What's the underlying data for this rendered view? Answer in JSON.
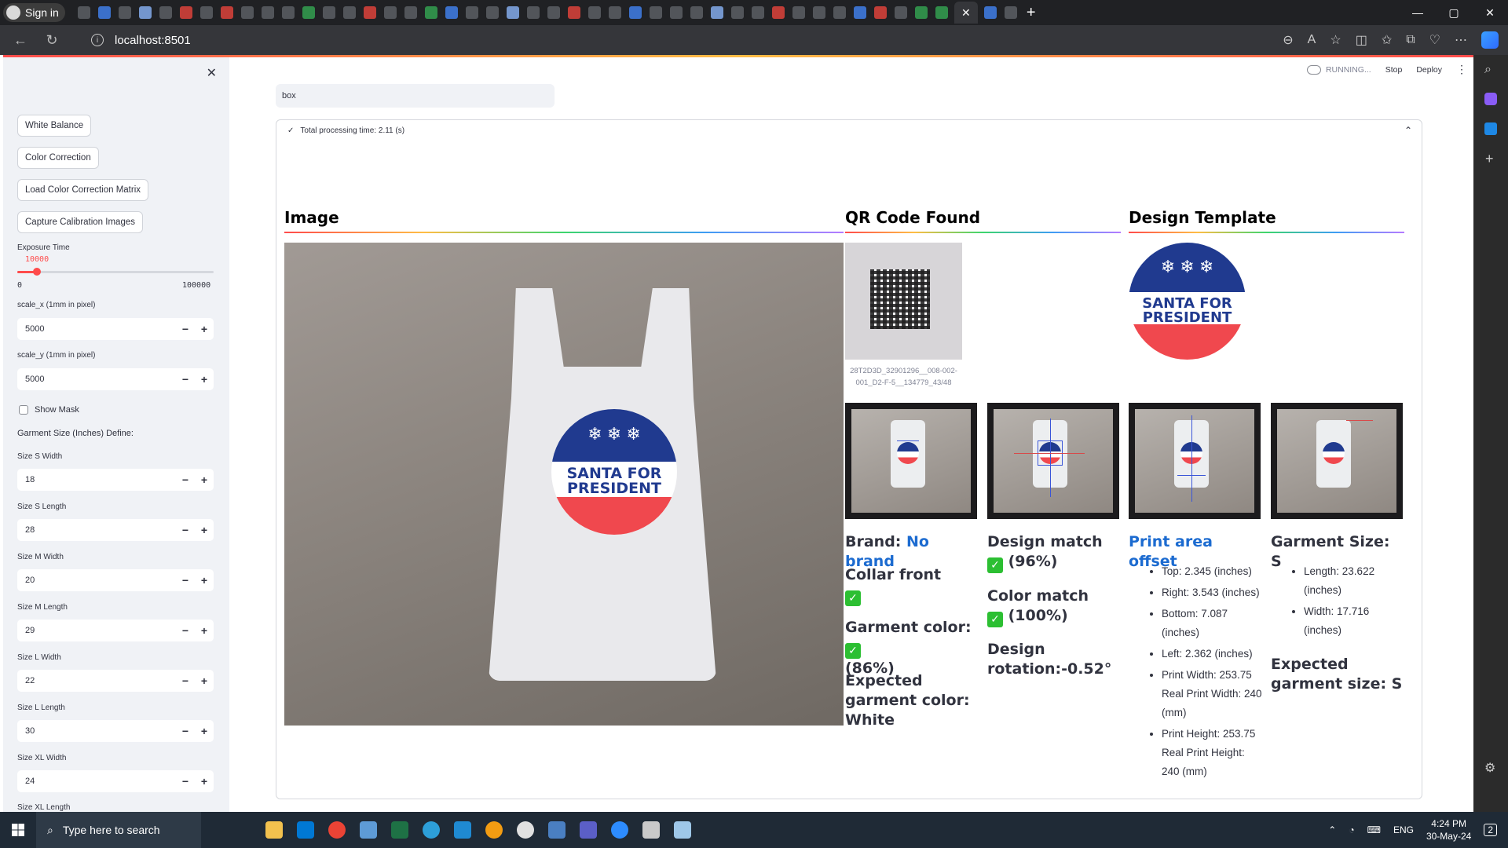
{
  "browser": {
    "profile_label": "Sign in",
    "url": "localhost:8501",
    "close_tab": "✕",
    "new_tab": "+",
    "win_min": "—",
    "win_max": "▢",
    "win_close": "✕"
  },
  "sidebar": {
    "close": "✕",
    "buttons": [
      "White Balance",
      "Color Correction",
      "Load Color Correction Matrix",
      "Capture Calibration Images"
    ],
    "exposure": {
      "label": "Exposure Time",
      "value": "10000",
      "min": "0",
      "max": "100000",
      "fraction": 0.1
    },
    "scale_x": {
      "label": "scale_x (1mm in pixel)",
      "value": "5000"
    },
    "scale_y": {
      "label": "scale_y (1mm in pixel)",
      "value": "5000"
    },
    "show_mask": "Show Mask",
    "size_define": "Garment Size (Inches) Define:",
    "sizes": [
      {
        "label": "Size S Width",
        "value": "18"
      },
      {
        "label": "Size S Length",
        "value": "28"
      },
      {
        "label": "Size M Width",
        "value": "20"
      },
      {
        "label": "Size M Length",
        "value": "29"
      },
      {
        "label": "Size L Width",
        "value": "22"
      },
      {
        "label": "Size L Length",
        "value": "30"
      },
      {
        "label": "Size XL Width",
        "value": "24"
      }
    ],
    "last_label": "Size XL Length",
    "minus": "−",
    "plus": "+"
  },
  "header": {
    "running": "RUNNING...",
    "stop": "Stop",
    "deploy": "Deploy",
    "menu": "⋮"
  },
  "main": {
    "search_value": "box",
    "processing": "Total processing time: 2.11 (s)",
    "check": "✓",
    "chevron": "⌃",
    "col_image": "Image",
    "col_qr": "QR Code Found",
    "col_template": "Design Template",
    "qr_caption": "28T2D3D_32901296__008-002-001_D2-F-5__134779_43/48",
    "logo_line1": "SANTA FOR",
    "logo_line2": "PRESIDENT",
    "logo_stars": "❄ ❄ ❄",
    "brand_label": "Brand: ",
    "brand_value": "No brand",
    "collar": "Collar front",
    "garment_color": "Garment color:",
    "garment_color_pct": "(86%)",
    "expected_color": "Expected garment color: White",
    "design_match": "Design match",
    "design_match_pct": "(96%)",
    "color_match": "Color match",
    "color_match_pct": "(100%)",
    "design_rotation": "Design rotation:-0.52°",
    "print_area": "Print area offset",
    "offsets": [
      "Top: 2.345 (inches)",
      "Right: 3.543 (inches)",
      "Bottom: 7.087 (inches)",
      "Left: 2.362 (inches)",
      "Print Width: 253.75 Real Print Width: 240 (mm)",
      "Print Height: 253.75 Real Print Height: 240 (mm)"
    ],
    "garment_size": "Garment Size: S",
    "size_items": [
      "Length: 23.622 (inches)",
      "Width: 17.716 (inches)"
    ],
    "expected_size": "Expected garment size: S",
    "ok_mark": "✓"
  },
  "taskbar": {
    "search_placeholder": "Type here to search",
    "lang": "ENG",
    "time": "4:24 PM",
    "date": "30-May-24",
    "notif": "2"
  }
}
